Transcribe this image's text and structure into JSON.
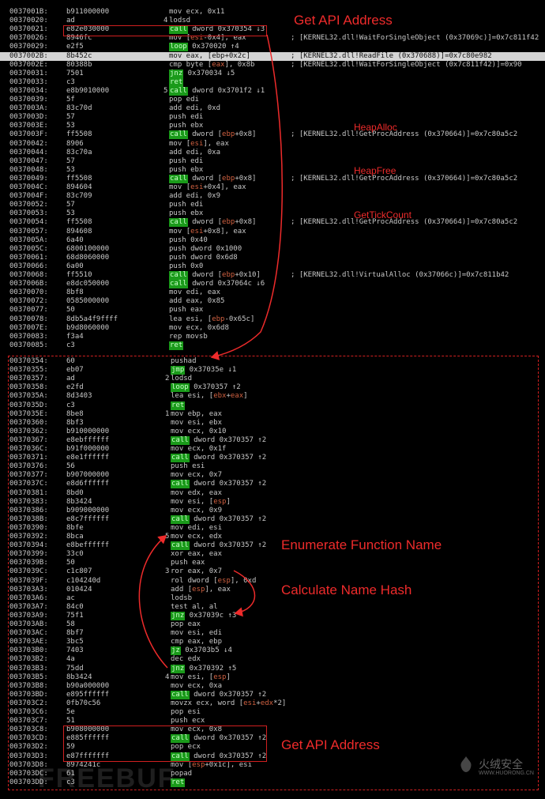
{
  "top_rows": [
    {
      "a": "0037001B:",
      "h": "b911000000",
      "f": "",
      "m": "mov ecx, 0x11",
      "j": "",
      "t": "",
      "c": ""
    },
    {
      "a": "00370020:",
      "h": "ad",
      "f": "4",
      "m": "lodsd",
      "j": "",
      "t": "",
      "c": ""
    },
    {
      "a": "00370021:",
      "h": "e82e030000",
      "f": "",
      "m": "",
      "j": "call",
      "t": " dword 0x370354 ↓3",
      "c": ""
    },
    {
      "a": "00370026:",
      "h": "8946fc",
      "f": "",
      "m": "mov [esi-0x4], eax",
      "j": "",
      "t": "",
      "c": "; [KERNEL32.dll!WaitForSingleObject (0x37069c)]=0x7c811f42"
    },
    {
      "a": "00370029:",
      "h": "e2f5",
      "f": "",
      "m": "",
      "j": "loop",
      "t": " 0x370020 ↑4",
      "c": ""
    },
    {
      "a": "0037002B:",
      "h": "8b452c",
      "f": "",
      "m": "mov eax, [ebp+0x2c]",
      "j": "",
      "t": "",
      "c": "; [KERNEL32.dll!ReadFile (0x370688)]=0x7c80e982",
      "hl": true
    },
    {
      "a": "0037002E:",
      "h": "80388b",
      "f": "",
      "m": "cmp byte [eax], 0x8b",
      "j": "",
      "t": "",
      "c": "; [KERNEL32.dll!WaitForSingleObject (0x7c811f42)]=0x90"
    },
    {
      "a": "00370031:",
      "h": "7501",
      "f": "",
      "m": "",
      "j": "jnz",
      "t": " 0x370034 ↓5",
      "c": ""
    },
    {
      "a": "00370033:",
      "h": "c3",
      "f": "",
      "m": "",
      "j": "ret",
      "t": "",
      "c": ""
    },
    {
      "a": "00370034:",
      "h": "e8b9010000",
      "f": "5",
      "m": "",
      "j": "call",
      "t": " dword 0x3701f2 ↓1",
      "c": ""
    },
    {
      "a": "00370039:",
      "h": "5f",
      "f": "",
      "m": "pop edi",
      "j": "",
      "t": "",
      "c": ""
    },
    {
      "a": "0037003A:",
      "h": "83c70d",
      "f": "",
      "m": "add edi, 0xd",
      "j": "",
      "t": "",
      "c": ""
    },
    {
      "a": "0037003D:",
      "h": "57",
      "f": "",
      "m": "push edi",
      "j": "",
      "t": "",
      "c": ""
    },
    {
      "a": "0037003E:",
      "h": "53",
      "f": "",
      "m": "push ebx",
      "j": "",
      "t": "",
      "c": ""
    },
    {
      "a": "0037003F:",
      "h": "ff5508",
      "f": "",
      "m": "",
      "j": "call",
      "t": " dword [ebp+0x8]",
      "c": "; [KERNEL32.dll!GetProcAddress (0x370664)]=0x7c80a5c2"
    },
    {
      "a": "00370042:",
      "h": "8906",
      "f": "",
      "m": "mov [esi], eax",
      "j": "",
      "t": "",
      "c": ""
    },
    {
      "a": "00370044:",
      "h": "83c70a",
      "f": "",
      "m": "add edi, 0xa",
      "j": "",
      "t": "",
      "c": ""
    },
    {
      "a": "00370047:",
      "h": "57",
      "f": "",
      "m": "push edi",
      "j": "",
      "t": "",
      "c": ""
    },
    {
      "a": "00370048:",
      "h": "53",
      "f": "",
      "m": "push ebx",
      "j": "",
      "t": "",
      "c": ""
    },
    {
      "a": "00370049:",
      "h": "ff5508",
      "f": "",
      "m": "",
      "j": "call",
      "t": " dword [ebp+0x8]",
      "c": "; [KERNEL32.dll!GetProcAddress (0x370664)]=0x7c80a5c2"
    },
    {
      "a": "0037004C:",
      "h": "894604",
      "f": "",
      "m": "mov [esi+0x4], eax",
      "j": "",
      "t": "",
      "c": ""
    },
    {
      "a": "0037004F:",
      "h": "83c709",
      "f": "",
      "m": "add edi, 0x9",
      "j": "",
      "t": "",
      "c": ""
    },
    {
      "a": "00370052:",
      "h": "57",
      "f": "",
      "m": "push edi",
      "j": "",
      "t": "",
      "c": ""
    },
    {
      "a": "00370053:",
      "h": "53",
      "f": "",
      "m": "push ebx",
      "j": "",
      "t": "",
      "c": ""
    },
    {
      "a": "00370054:",
      "h": "ff5508",
      "f": "",
      "m": "",
      "j": "call",
      "t": " dword [ebp+0x8]",
      "c": "; [KERNEL32.dll!GetProcAddress (0x370664)]=0x7c80a5c2"
    },
    {
      "a": "00370057:",
      "h": "894608",
      "f": "",
      "m": "mov [esi+0x8], eax",
      "j": "",
      "t": "",
      "c": ""
    },
    {
      "a": "0037005A:",
      "h": "6a40",
      "f": "",
      "m": "push 0x40",
      "j": "",
      "t": "",
      "c": ""
    },
    {
      "a": "0037005C:",
      "h": "6800100000",
      "f": "",
      "m": "push dword 0x1000",
      "j": "",
      "t": "",
      "c": ""
    },
    {
      "a": "00370061:",
      "h": "68d8060000",
      "f": "",
      "m": "push dword 0x6d8",
      "j": "",
      "t": "",
      "c": ""
    },
    {
      "a": "00370066:",
      "h": "6a00",
      "f": "",
      "m": "push 0x0",
      "j": "",
      "t": "",
      "c": ""
    },
    {
      "a": "00370068:",
      "h": "ff5510",
      "f": "",
      "m": "",
      "j": "call",
      "t": " dword [ebp+0x10]",
      "c": "; [KERNEL32.dll!VirtualAlloc (0x37066c)]=0x7c811b42"
    },
    {
      "a": "0037006B:",
      "h": "e8dc050000",
      "f": "",
      "m": "",
      "j": "call",
      "t": " dword 0x37064c ↓6",
      "c": ""
    },
    {
      "a": "00370070:",
      "h": "8bf8",
      "f": "",
      "m": "mov edi, eax",
      "j": "",
      "t": "",
      "c": ""
    },
    {
      "a": "00370072:",
      "h": "0585000000",
      "f": "",
      "m": "add eax, 0x85",
      "j": "",
      "t": "",
      "c": ""
    },
    {
      "a": "00370077:",
      "h": "50",
      "f": "",
      "m": "push eax",
      "j": "",
      "t": "",
      "c": ""
    },
    {
      "a": "00370078:",
      "h": "8db5a4f9ffff",
      "f": "",
      "m": "lea esi, [ebp-0x65c]",
      "j": "",
      "t": "",
      "c": ""
    },
    {
      "a": "0037007E:",
      "h": "b9d8060000",
      "f": "",
      "m": "mov ecx, 0x6d8",
      "j": "",
      "t": "",
      "c": ""
    },
    {
      "a": "00370083:",
      "h": "f3a4",
      "f": "",
      "m": "rep movsb",
      "j": "",
      "t": "",
      "c": ""
    },
    {
      "a": "00370085:",
      "h": "c3",
      "f": "",
      "m": "",
      "j": "ret",
      "t": "",
      "c": ""
    }
  ],
  "bottom_rows": [
    {
      "a": "00370354:",
      "h": "60",
      "f": "",
      "m": "pushad",
      "j": "",
      "t": ""
    },
    {
      "a": "00370355:",
      "h": "eb07",
      "f": "",
      "m": "",
      "j": "jmp",
      "t": " 0x37035e ↓1"
    },
    {
      "a": "00370357:",
      "h": "ad",
      "f": "2",
      "m": "lodsd",
      "j": "",
      "t": ""
    },
    {
      "a": "00370358:",
      "h": "e2fd",
      "f": "",
      "m": "",
      "j": "loop",
      "t": " 0x370357 ↑2"
    },
    {
      "a": "0037035A:",
      "h": "8d3403",
      "f": "",
      "m": "lea esi, [ebx+eax]",
      "j": "",
      "t": ""
    },
    {
      "a": "0037035D:",
      "h": "c3",
      "f": "",
      "m": "",
      "j": "ret",
      "t": ""
    },
    {
      "a": "0037035E:",
      "h": "8be8",
      "f": "1",
      "m": "mov ebp, eax",
      "j": "",
      "t": ""
    },
    {
      "a": "00370360:",
      "h": "8bf3",
      "f": "",
      "m": "mov esi, ebx",
      "j": "",
      "t": ""
    },
    {
      "a": "00370362:",
      "h": "b910000000",
      "f": "",
      "m": "mov ecx, 0x10",
      "j": "",
      "t": ""
    },
    {
      "a": "00370367:",
      "h": "e8ebffffff",
      "f": "",
      "m": "",
      "j": "call",
      "t": " dword 0x370357 ↑2"
    },
    {
      "a": "0037036C:",
      "h": "b91f000000",
      "f": "",
      "m": "mov ecx, 0x1f",
      "j": "",
      "t": ""
    },
    {
      "a": "00370371:",
      "h": "e8e1ffffff",
      "f": "",
      "m": "",
      "j": "call",
      "t": " dword 0x370357 ↑2"
    },
    {
      "a": "00370376:",
      "h": "56",
      "f": "",
      "m": "push esi",
      "j": "",
      "t": ""
    },
    {
      "a": "00370377:",
      "h": "b907000000",
      "f": "",
      "m": "mov ecx, 0x7",
      "j": "",
      "t": ""
    },
    {
      "a": "0037037C:",
      "h": "e8d6ffffff",
      "f": "",
      "m": "",
      "j": "call",
      "t": " dword 0x370357 ↑2"
    },
    {
      "a": "00370381:",
      "h": "8bd0",
      "f": "",
      "m": "mov edx, eax",
      "j": "",
      "t": ""
    },
    {
      "a": "00370383:",
      "h": "8b3424",
      "f": "",
      "m": "mov esi, [esp]",
      "j": "",
      "t": ""
    },
    {
      "a": "00370386:",
      "h": "b909000000",
      "f": "",
      "m": "mov ecx, 0x9",
      "j": "",
      "t": ""
    },
    {
      "a": "0037038B:",
      "h": "e8c7ffffff",
      "f": "",
      "m": "",
      "j": "call",
      "t": " dword 0x370357 ↑2"
    },
    {
      "a": "00370390:",
      "h": "8bfe",
      "f": "",
      "m": "mov edi, esi",
      "j": "",
      "t": ""
    },
    {
      "a": "00370392:",
      "h": "8bca",
      "f": "5",
      "m": "mov ecx, edx",
      "j": "",
      "t": ""
    },
    {
      "a": "00370394:",
      "h": "e8beffffff",
      "f": "",
      "m": "",
      "j": "call",
      "t": " dword 0x370357 ↑2"
    },
    {
      "a": "00370399:",
      "h": "33c0",
      "f": "",
      "m": "xor eax, eax",
      "j": "",
      "t": ""
    },
    {
      "a": "0037039B:",
      "h": "50",
      "f": "",
      "m": "push eax",
      "j": "",
      "t": ""
    },
    {
      "a": "0037039C:",
      "h": "c1c807",
      "f": "3",
      "m": "ror eax, 0x7",
      "j": "",
      "t": ""
    },
    {
      "a": "0037039F:",
      "h": "c104240d",
      "f": "",
      "m": "rol dword [esp], 0xd",
      "j": "",
      "t": ""
    },
    {
      "a": "003703A3:",
      "h": "010424",
      "f": "",
      "m": "add [esp], eax",
      "j": "",
      "t": ""
    },
    {
      "a": "003703A6:",
      "h": "ac",
      "f": "",
      "m": "lodsb",
      "j": "",
      "t": ""
    },
    {
      "a": "003703A7:",
      "h": "84c0",
      "f": "",
      "m": "test al, al",
      "j": "",
      "t": ""
    },
    {
      "a": "003703A9:",
      "h": "75f1",
      "f": "",
      "m": "",
      "j": "jnz",
      "t": " 0x37039c ↑3"
    },
    {
      "a": "003703AB:",
      "h": "58",
      "f": "",
      "m": "pop eax",
      "j": "",
      "t": ""
    },
    {
      "a": "003703AC:",
      "h": "8bf7",
      "f": "",
      "m": "mov esi, edi",
      "j": "",
      "t": ""
    },
    {
      "a": "003703AE:",
      "h": "3bc5",
      "f": "",
      "m": "cmp eax, ebp",
      "j": "",
      "t": ""
    },
    {
      "a": "003703B0:",
      "h": "7403",
      "f": "",
      "m": "",
      "j": "jz",
      "t": " 0x3703b5 ↓4"
    },
    {
      "a": "003703B2:",
      "h": "4a",
      "f": "",
      "m": "dec edx",
      "j": "",
      "t": ""
    },
    {
      "a": "003703B3:",
      "h": "75dd",
      "f": "",
      "m": "",
      "j": "jnz",
      "t": " 0x370392 ↑5"
    },
    {
      "a": "003703B5:",
      "h": "8b3424",
      "f": "4",
      "m": "mov esi, [esp]",
      "j": "",
      "t": ""
    },
    {
      "a": "003703B8:",
      "h": "b90a000000",
      "f": "",
      "m": "mov ecx, 0xa",
      "j": "",
      "t": ""
    },
    {
      "a": "003703BD:",
      "h": "e895ffffff",
      "f": "",
      "m": "",
      "j": "call",
      "t": " dword 0x370357 ↑2"
    },
    {
      "a": "003703C2:",
      "h": "0fb70c56",
      "f": "",
      "m": "movzx ecx, word [esi+edx*2]",
      "j": "",
      "t": ""
    },
    {
      "a": "003703C6:",
      "h": "5e",
      "f": "",
      "m": "pop esi",
      "j": "",
      "t": ""
    },
    {
      "a": "003703C7:",
      "h": "51",
      "f": "",
      "m": "push ecx",
      "j": "",
      "t": ""
    },
    {
      "a": "003703C8:",
      "h": "b908000000",
      "f": "",
      "m": "mov ecx, 0x8",
      "j": "",
      "t": ""
    },
    {
      "a": "003703CD:",
      "h": "e885ffffff",
      "f": "",
      "m": "",
      "j": "call",
      "t": " dword 0x370357 ↑2"
    },
    {
      "a": "003703D2:",
      "h": "59",
      "f": "",
      "m": "pop ecx",
      "j": "",
      "t": ""
    },
    {
      "a": "003703D3:",
      "h": "e87fffffff",
      "f": "",
      "m": "",
      "j": "call",
      "t": " dword 0x370357 ↑2"
    },
    {
      "a": "003703D8:",
      "h": "8974241c",
      "f": "",
      "m": "mov [esp+0x1c], esi",
      "j": "",
      "t": ""
    },
    {
      "a": "003703DC:",
      "h": "61",
      "f": "",
      "m": "popad",
      "j": "",
      "t": ""
    },
    {
      "a": "003703DD:",
      "h": "c3",
      "f": "",
      "m": "",
      "j": "ret",
      "t": ""
    }
  ],
  "annotations": {
    "get_api_top": "Get API Address",
    "heap_alloc": "HeapAlloc",
    "heap_free": "HeapFree",
    "get_tick_count": "GetTickCount",
    "enumerate": "Enumerate Function Name",
    "calc_hash": "Calculate Name Hash",
    "get_api_bottom": "Get API Address"
  },
  "watermark": {
    "left_text": "FREEBUF",
    "brand_cn": "火绒安全",
    "brand_url": "WWW.HUORONG.CN"
  },
  "colors": {
    "accent_red": "#ee2b2b",
    "jump_green": "#1a9a1a",
    "highlight_row": "#d4d4d4"
  }
}
